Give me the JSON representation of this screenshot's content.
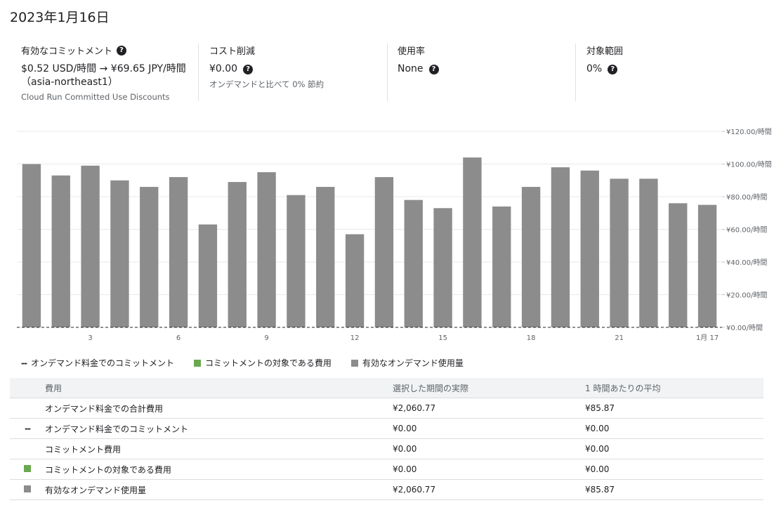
{
  "page": {
    "title": "2023年1月16日"
  },
  "summary": {
    "commitment": {
      "label": "有効なコミットメント",
      "value": "$0.52 USD/時間 → ¥69.65 JPY/時間（asia-northeast1）",
      "sub": "Cloud Run Committed Use Discounts"
    },
    "cost_savings": {
      "label": "コスト削減",
      "value": "¥0.00",
      "sub": "オンデマンドと比べて 0% 節約"
    },
    "utilization": {
      "label": "使用率",
      "value": "None"
    },
    "coverage": {
      "label": "対象範囲",
      "value": "0%"
    }
  },
  "colors": {
    "bar": "#8c8c8c",
    "covered": "#6aa84f",
    "grid": "#e8eaed",
    "text": "#5f6368"
  },
  "chart_data": {
    "type": "bar",
    "categories": [
      "",
      "",
      "3",
      "",
      "",
      "6",
      "",
      "",
      "9",
      "",
      "",
      "12",
      "",
      "",
      "15",
      "",
      "",
      "18",
      "",
      "",
      "21",
      "",
      "",
      "1月 17"
    ],
    "series": [
      {
        "name": "有効なオンデマンド使用量",
        "values": [
          100,
          93,
          99,
          90,
          86,
          92,
          63,
          89,
          95,
          81,
          86,
          57,
          92,
          78,
          73,
          104,
          74,
          86,
          98,
          96,
          91,
          91,
          76,
          75
        ]
      },
      {
        "name": "コミットメントの対象である費用",
        "values": []
      },
      {
        "name": "オンデマンド料金でのコミットメント",
        "values": [
          0,
          0,
          0,
          0,
          0,
          0,
          0,
          0,
          0,
          0,
          0,
          0,
          0,
          0,
          0,
          0,
          0,
          0,
          0,
          0,
          0,
          0,
          0,
          0
        ]
      }
    ],
    "y_ticks": [
      "¥0.00/時間",
      "¥20.00/時間",
      "¥40.00/時間",
      "¥60.00/時間",
      "¥80.00/時間",
      "¥100.00/時間",
      "¥120.00/時間"
    ],
    "ylim": [
      0,
      120
    ],
    "grid": true,
    "legend_position": "bottom-left"
  },
  "legend": [
    {
      "swatch": "--",
      "label": "オンデマンド料金でのコミットメント"
    },
    {
      "swatch": "green-square",
      "label": "コミットメントの対象である費用"
    },
    {
      "swatch": "gray-square",
      "label": "有効なオンデマンド使用量"
    }
  ],
  "table": {
    "headers": [
      "",
      "費用",
      "選択した期間の実際",
      "1 時間あたりの平均"
    ],
    "rows": [
      {
        "marker": "",
        "label": "オンデマンド料金での合計費用",
        "actual": "¥2,060.77",
        "avg": "¥85.87"
      },
      {
        "marker": "--",
        "label": "オンデマンド料金でのコミットメント",
        "actual": "¥0.00",
        "avg": "¥0.00"
      },
      {
        "marker": "",
        "label": "コミットメント費用",
        "actual": "¥0.00",
        "avg": "¥0.00"
      },
      {
        "marker": "green-square",
        "label": "コミットメントの対象である費用",
        "actual": "¥0.00",
        "avg": "¥0.00"
      },
      {
        "marker": "gray-square",
        "label": "有効なオンデマンド使用量",
        "actual": "¥2,060.77",
        "avg": "¥85.87"
      }
    ]
  }
}
